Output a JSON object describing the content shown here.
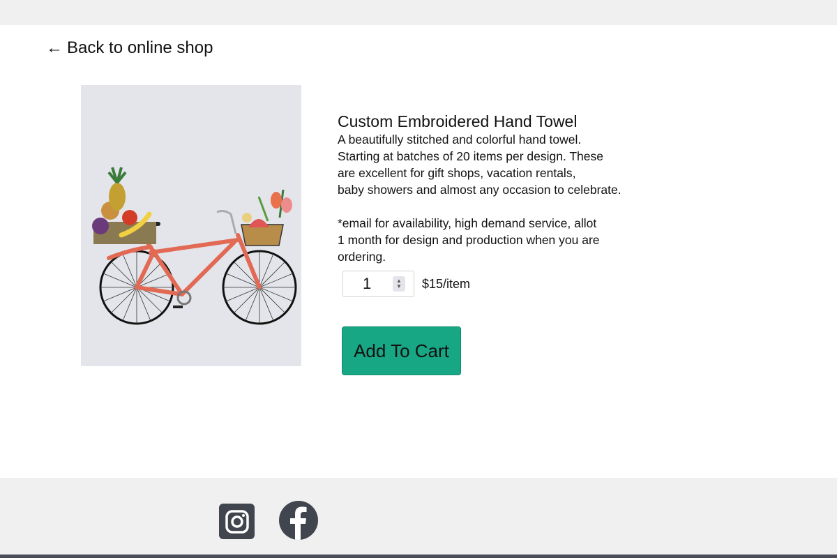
{
  "nav": {
    "back_arrow": "←",
    "back_label": "Back to online shop"
  },
  "product": {
    "image_alt": "embroidered bicycle with fruit basket",
    "title": "Custom Embroidered Hand Towel",
    "description": "A beautifully stitched and colorful hand towel.\nStarting at batches of 20 items per design. These\nare excellent for gift shops, vacation rentals,\nbaby showers and almost any occasion to celebrate.",
    "note": "*email for availability, high demand service, allot\n1 month for design and production when you are\nordering.",
    "quantity": "1",
    "price": "$15/item",
    "add_to_cart_label": "Add To Cart"
  },
  "footer": {
    "social": [
      {
        "name": "instagram-icon"
      },
      {
        "name": "facebook-icon"
      }
    ]
  },
  "colors": {
    "button_bg": "#17a785",
    "icon_bg": "#41454d",
    "page_strip": "#f0f0f1"
  }
}
